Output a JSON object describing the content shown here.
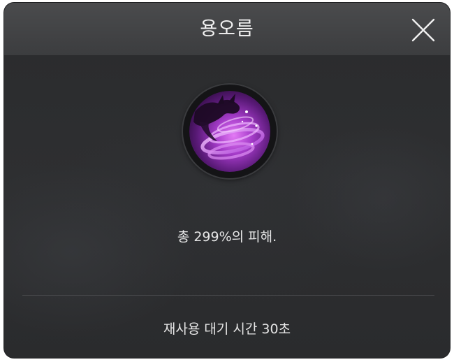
{
  "dialog": {
    "title": "용오름",
    "close_icon": "close-icon",
    "skill_icon": "purple-dragon-tornado-icon",
    "description": "총 299%의 피해.",
    "cooldown": "재사용 대기 시간 30초",
    "colors": {
      "background": "#2b2c2e",
      "header": "#444547",
      "text": "#e6e6e6",
      "accent": "#b04ad8"
    }
  }
}
